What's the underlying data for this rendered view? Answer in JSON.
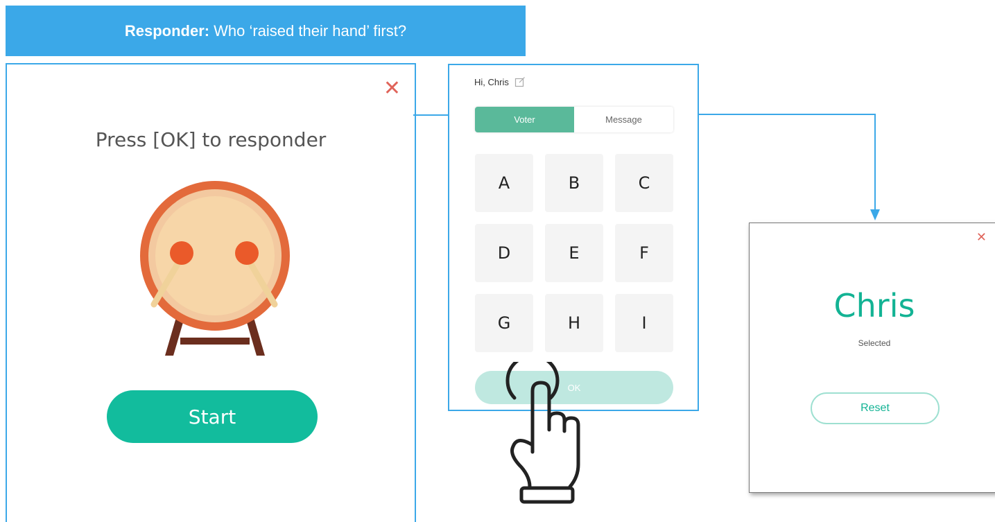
{
  "banner": {
    "label": "Responder:",
    "text": "Who ‘raised their hand’ first?"
  },
  "responder_panel": {
    "close_glyph": "✕",
    "prompt": "Press [OK] to responder",
    "start_label": "Start",
    "drum_icon": "drum-icon"
  },
  "voter_panel": {
    "greeting": "Hi, Chris",
    "edit_icon": "edit-icon",
    "tabs": [
      {
        "label": "Voter",
        "active": true
      },
      {
        "label": "Message",
        "active": false
      }
    ],
    "keys": [
      "A",
      "B",
      "C",
      "D",
      "E",
      "F",
      "G",
      "H",
      "I"
    ],
    "ok_label": "OK"
  },
  "result_panel": {
    "close_glyph": "✕",
    "winner": "Chris",
    "status": "Selected",
    "reset_label": "Reset"
  },
  "colors": {
    "accent_blue": "#3ba8e8",
    "teal": "#12bc9d",
    "close_red": "#e0645a"
  }
}
